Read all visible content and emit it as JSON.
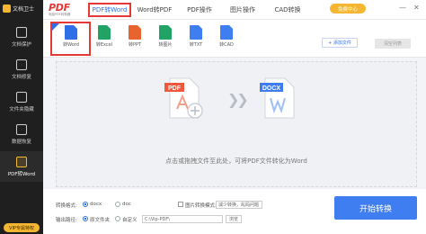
{
  "app": {
    "brand_name": "文档卫士",
    "logo_text": "PDF",
    "logo_subtitle": "电脑PDF转换器"
  },
  "sidebar": {
    "items": [
      {
        "label": "文档保护",
        "icon": "shield-icon"
      },
      {
        "label": "文档修复",
        "icon": "wrench-icon"
      },
      {
        "label": "文件夹隐藏",
        "icon": "folder-icon"
      },
      {
        "label": "数据恢复",
        "icon": "restore-icon"
      },
      {
        "label": "PDF转Word",
        "icon": "pdf-convert-icon",
        "active": true
      }
    ],
    "bottom_label": "VIP专属特权"
  },
  "topbar": {
    "tabs": [
      {
        "label": "PDF转Word",
        "active": true
      },
      {
        "label": "Word转PDF"
      },
      {
        "label": "PDF操作"
      },
      {
        "label": "图片操作"
      },
      {
        "label": "CAD转换"
      }
    ],
    "vip_label": "免费中心",
    "minimize": "—",
    "close": "✕"
  },
  "formats": {
    "items": [
      {
        "label": "转Word",
        "color": "#2e6fe8",
        "selected": true
      },
      {
        "label": "转Excel",
        "color": "#21a366"
      },
      {
        "label": "转PPT",
        "color": "#e8642e"
      },
      {
        "label": "转图片",
        "color": "#21a366"
      },
      {
        "label": "转TXT",
        "color": "#3f7ef0"
      },
      {
        "label": "转CAD",
        "color": "#3f7ef0"
      }
    ],
    "add_button": "+ 添加文件",
    "clear_button": "清空列表"
  },
  "dropzone": {
    "source_label": "PDF",
    "target_label": "DOCX",
    "hint": "点击或拖拽文件至此处，可将PDF文件转化为Word"
  },
  "settings": {
    "format_label": "转换格式:",
    "format_options": [
      "docx",
      "doc"
    ],
    "format_selected": "docx",
    "ocr_label": "图片转换模式:",
    "ocr_select": "减少转换，乱码问题",
    "output_label": "输出路径:",
    "output_option_source": "原文件夹",
    "output_option_custom": "自定义",
    "output_path": "C:\\Vip-PDF\\",
    "browse_button": "浏览",
    "start_button": "开始转换"
  },
  "colors": {
    "accent": "#2e6fe8",
    "highlight_box": "#e53935",
    "vip": "#f5b731",
    "start_button": "#3f7ef0",
    "sidebar_bg": "#1f1f1f"
  }
}
